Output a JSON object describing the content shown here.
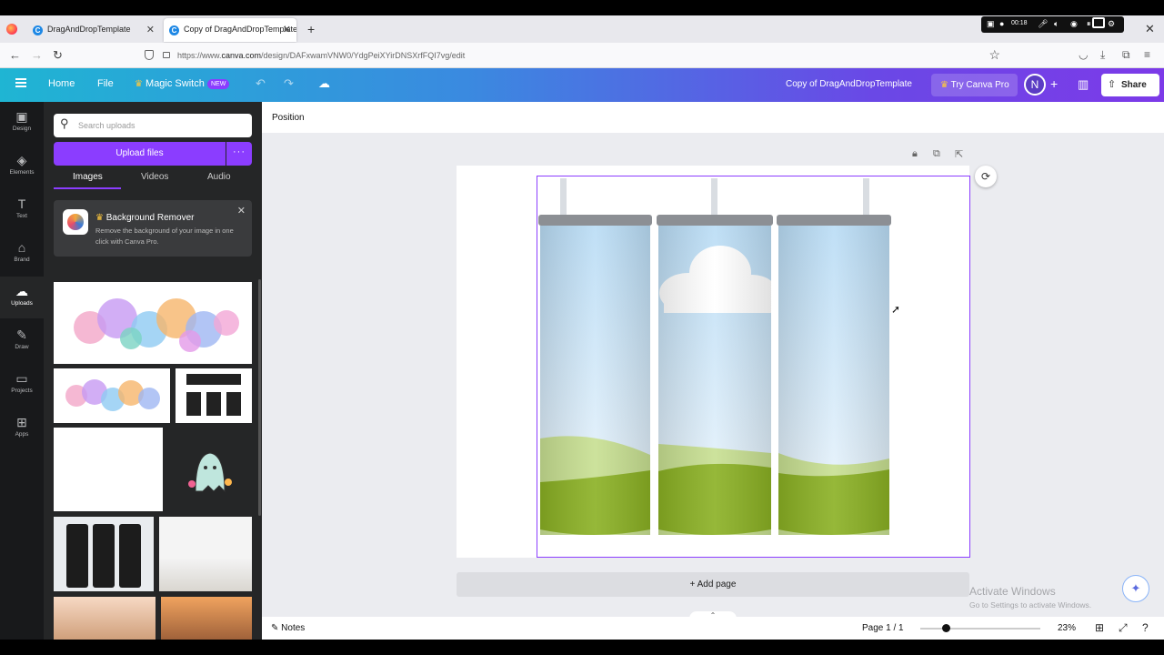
{
  "browser": {
    "tabs": [
      {
        "title": "DragAndDropTemplate"
      },
      {
        "title": "Copy of DragAndDropTemplate"
      }
    ],
    "url_prefix": "https://www.",
    "url_host": "canva.com",
    "url_path": "/design/DAFxwamVNW0/YdgPeiXYirDNSXrfFQI7vg/edit",
    "recording_time": "00:18"
  },
  "header": {
    "home": "Home",
    "file": "File",
    "magic_switch": "Magic Switch",
    "new_badge": "NEW",
    "doc_title": "Copy of DragAndDropTemplate",
    "try_pro": "Try Canva Pro",
    "avatar_initial": "N",
    "share": "Share"
  },
  "rail": {
    "items": [
      {
        "label": "Design",
        "icon": "layout-icon"
      },
      {
        "label": "Elements",
        "icon": "shapes-icon"
      },
      {
        "label": "Text",
        "icon": "text-icon"
      },
      {
        "label": "Brand",
        "icon": "brand-icon"
      },
      {
        "label": "Uploads",
        "icon": "cloud-upload-icon"
      },
      {
        "label": "Draw",
        "icon": "pen-icon"
      },
      {
        "label": "Projects",
        "icon": "folder-icon"
      },
      {
        "label": "Apps",
        "icon": "apps-grid-icon"
      }
    ],
    "active": "Uploads"
  },
  "uploads_panel": {
    "search_placeholder": "Search uploads",
    "upload_button": "Upload files",
    "tabs": [
      "Images",
      "Videos",
      "Audio"
    ],
    "active_tab": "Images",
    "promo_title": "Background Remover",
    "promo_desc": "Remove the background of your image in one click with Canva Pro."
  },
  "editor": {
    "toolbar_label": "Position",
    "add_page": "+ Add page",
    "notes": "Notes",
    "page_indicator": "Page 1 / 1",
    "zoom": "23%",
    "zoom_fraction": 0.23
  },
  "watermark": {
    "line1": "Activate Windows",
    "line2": "Go to Settings to activate Windows."
  },
  "colors": {
    "brand_purple": "#8b3dff",
    "header_start": "#1fb5d3",
    "header_end": "#7c3ae8",
    "sky": "#cfe6f7",
    "grass": "#8ab023"
  }
}
